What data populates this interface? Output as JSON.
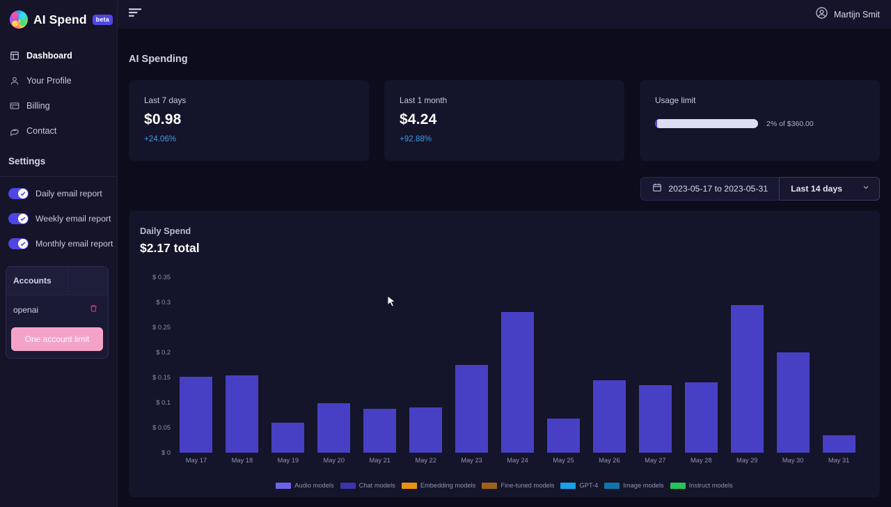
{
  "brand": {
    "name": "AI Spend",
    "badge": "beta",
    "logo_icon": "brain-logo-icon"
  },
  "topbar": {
    "menu_icon": "filter-lines-icon",
    "user_name": "Martijn Smit",
    "user_icon": "user-circle-icon"
  },
  "sidebar": {
    "nav": [
      {
        "label": "Dashboard",
        "icon": "layout-dashboard-icon",
        "active": true
      },
      {
        "label": "Your Profile",
        "icon": "user-icon",
        "active": false
      },
      {
        "label": "Billing",
        "icon": "credit-card-icon",
        "active": false
      },
      {
        "label": "Contact",
        "icon": "chat-bubble-icon",
        "active": false
      }
    ],
    "settings_title": "Settings",
    "toggles": [
      {
        "label": "Daily email report",
        "on": true
      },
      {
        "label": "Weekly email report",
        "on": true
      },
      {
        "label": "Monthly email report",
        "on": true
      }
    ],
    "accounts": {
      "header": "Accounts",
      "rows": [
        {
          "name": "openai",
          "delete_icon": "trash-icon"
        }
      ],
      "button": "One account limit"
    }
  },
  "main": {
    "page_title": "AI Spending",
    "cards": [
      {
        "label": "Last 7 days",
        "value": "$0.98",
        "delta": "+24.06%"
      },
      {
        "label": "Last 1 month",
        "value": "$4.24",
        "delta": "+92.88%"
      }
    ],
    "usage": {
      "label": "Usage limit",
      "percent": 2,
      "text": "2% of $360.00",
      "track_color": "#dcdcf2",
      "fill_color": "#4f46e5"
    },
    "controls": {
      "calendar_icon": "calendar-icon",
      "date_range": "2023-05-17 to 2023-05-31",
      "range_preset": "Last 14 days",
      "chevron_icon": "chevron-down-icon"
    }
  },
  "chart_data": {
    "type": "bar",
    "title": "Daily Spend",
    "subtitle": "$2.17 total",
    "xlabel": "",
    "ylabel": "",
    "grid": false,
    "legend_position": "bottom",
    "ylim": [
      0,
      0.35
    ],
    "ytick_labels": [
      "$ 0",
      "$ 0.05",
      "$ 0.1",
      "$ 0.15",
      "$ 0.2",
      "$ 0.25",
      "$ 0.3",
      "$ 0.35"
    ],
    "yticks": [
      0,
      0.05,
      0.1,
      0.15,
      0.2,
      0.25,
      0.3,
      0.35
    ],
    "categories": [
      "May 17",
      "May 18",
      "May 19",
      "May 20",
      "May 21",
      "May 22",
      "May 23",
      "May 24",
      "May 25",
      "May 26",
      "May 27",
      "May 28",
      "May 29",
      "May 30",
      "May 31"
    ],
    "values": [
      0.152,
      0.154,
      0.06,
      0.098,
      0.088,
      0.09,
      0.175,
      0.28,
      0.068,
      0.145,
      0.135,
      0.14,
      0.295,
      0.2,
      0.035
    ],
    "bar_color": "#4840c4",
    "series": [
      {
        "name": "Chat models",
        "values": [
          0.152,
          0.154,
          0.06,
          0.098,
          0.088,
          0.09,
          0.175,
          0.28,
          0.068,
          0.145,
          0.135,
          0.14,
          0.295,
          0.2,
          0.035
        ]
      }
    ],
    "legend": [
      {
        "label": "Audio models",
        "color": "#6b63e8"
      },
      {
        "label": "Chat models",
        "color": "#3b35a8"
      },
      {
        "label": "Embedding models",
        "color": "#e8920f"
      },
      {
        "label": "Fine-tuned models",
        "color": "#9a6212"
      },
      {
        "label": "GPT-4",
        "color": "#17a2e8"
      },
      {
        "label": "Image models",
        "color": "#1173a8"
      },
      {
        "label": "Instruct models",
        "color": "#25c45c"
      }
    ]
  }
}
